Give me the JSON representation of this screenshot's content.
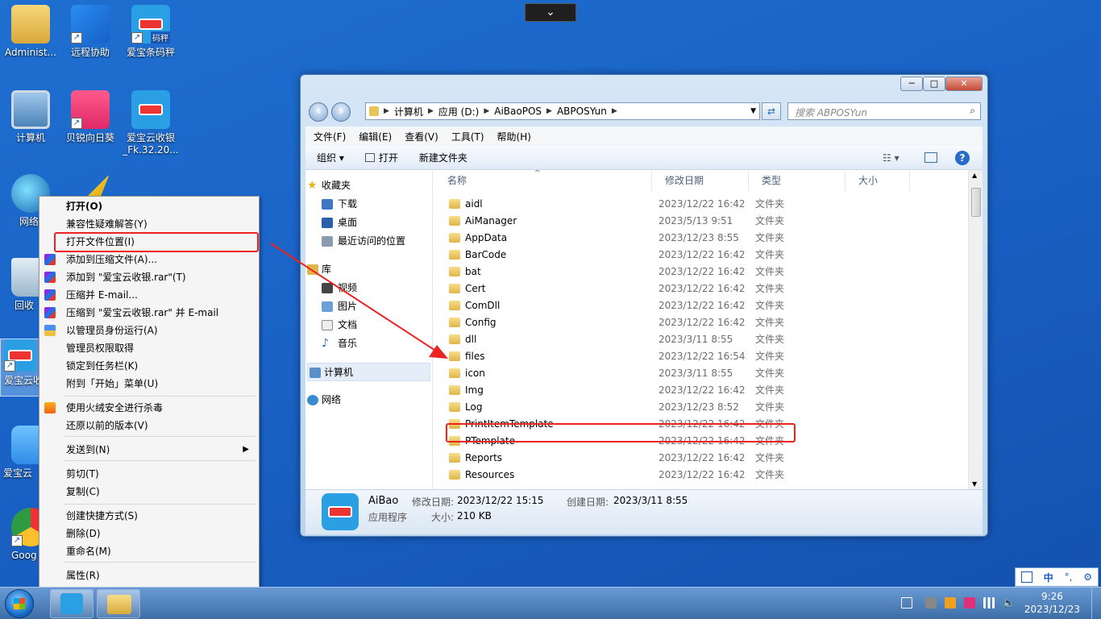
{
  "desktop": {
    "icons": [
      {
        "label": "Administ..."
      },
      {
        "label": "远程协助"
      },
      {
        "label": "爱宝条码秤"
      },
      {
        "label": "计算机"
      },
      {
        "label": "贝锐向日葵"
      },
      {
        "label": "爱宝云收银"
      },
      {
        "label": "_Fk.32.20..."
      },
      {
        "label": "网络"
      },
      {
        "label": "回收"
      },
      {
        "label": "爱宝云"
      },
      {
        "label": "爱宝云收"
      },
      {
        "label": "Goog"
      }
    ],
    "badge_text": "码秤"
  },
  "top_dropdown": {
    "glyph": "⌄"
  },
  "explorer": {
    "window_buttons": {
      "minimize": "─",
      "maximize": "□",
      "close": "✕"
    },
    "nav": {
      "back": "‹",
      "forward": "›"
    },
    "address": {
      "crumbs": [
        "计算机",
        "应用 (D:)",
        "AiBaoPOS",
        "ABPOSYun"
      ]
    },
    "search": {
      "placeholder": "搜索 ABPOSYun"
    },
    "menu": [
      "文件(F)",
      "编辑(E)",
      "查看(V)",
      "工具(T)",
      "帮助(H)"
    ],
    "toolbar": {
      "organize": "组织 ▾",
      "open": "打开",
      "new_folder": "新建文件夹",
      "help": "?"
    },
    "navpane": {
      "favorites": "收藏夹",
      "downloads": "下载",
      "desktop": "桌面",
      "recent": "最近访问的位置",
      "library": "库",
      "videos": "视频",
      "pictures": "图片",
      "documents": "文档",
      "music": "音乐",
      "computer": "计算机",
      "network": "网络"
    },
    "columns": {
      "name": "名称",
      "date": "修改日期",
      "type": "类型",
      "size": "大小"
    },
    "files": [
      {
        "name": "aidl",
        "date": "2023/12/22 16:42",
        "type": "文件夹"
      },
      {
        "name": "AiManager",
        "date": "2023/5/13 9:51",
        "type": "文件夹"
      },
      {
        "name": "AppData",
        "date": "2023/12/23 8:55",
        "type": "文件夹"
      },
      {
        "name": "BarCode",
        "date": "2023/12/22 16:42",
        "type": "文件夹"
      },
      {
        "name": "bat",
        "date": "2023/12/22 16:42",
        "type": "文件夹"
      },
      {
        "name": "Cert",
        "date": "2023/12/22 16:42",
        "type": "文件夹"
      },
      {
        "name": "ComDll",
        "date": "2023/12/22 16:42",
        "type": "文件夹"
      },
      {
        "name": "Config",
        "date": "2023/12/22 16:42",
        "type": "文件夹"
      },
      {
        "name": "dll",
        "date": "2023/3/11 8:55",
        "type": "文件夹"
      },
      {
        "name": "files",
        "date": "2023/12/22 16:54",
        "type": "文件夹"
      },
      {
        "name": "icon",
        "date": "2023/3/11 8:55",
        "type": "文件夹"
      },
      {
        "name": "Img",
        "date": "2023/12/22 16:42",
        "type": "文件夹"
      },
      {
        "name": "Log",
        "date": "2023/12/23 8:52",
        "type": "文件夹"
      },
      {
        "name": "PrintItemTemplate",
        "date": "2023/12/22 16:42",
        "type": "文件夹"
      },
      {
        "name": "PTemplate",
        "date": "2023/12/22 16:42",
        "type": "文件夹"
      },
      {
        "name": "Reports",
        "date": "2023/12/22 16:42",
        "type": "文件夹"
      },
      {
        "name": "Resources",
        "date": "2023/12/22 16:42",
        "type": "文件夹"
      }
    ],
    "highlighted_row": "files",
    "details": {
      "name": "AiBao",
      "kind": "应用程序",
      "modified_label": "修改日期:",
      "modified_value": "2023/12/22 15:15",
      "created_label": "创建日期:",
      "created_value": "2023/3/11 8:55",
      "size_label": "大小:",
      "size_value": "210 KB"
    }
  },
  "context_menu": {
    "items": [
      {
        "label": "打开(O)",
        "bold": true
      },
      {
        "label": "兼容性疑难解答(Y)"
      },
      {
        "label": "打开文件位置(I)",
        "highlighted": true
      },
      {
        "label": "添加到压缩文件(A)...",
        "icon": "rar-icon"
      },
      {
        "label": "添加到 \"爱宝云收银.rar\"(T)",
        "icon": "rar-icon"
      },
      {
        "label": "压缩并 E-mail...",
        "icon": "rar-icon"
      },
      {
        "label": "压缩到 \"爱宝云收银.rar\" 并 E-mail",
        "icon": "rar-icon"
      },
      {
        "label": "以管理员身份运行(A)",
        "icon": "uac-shield-icon"
      },
      {
        "label": "管理员权限取得"
      },
      {
        "label": "锁定到任务栏(K)"
      },
      {
        "label": "附到「开始」菜单(U)"
      },
      {
        "label": "使用火绒安全进行杀毒",
        "icon": "huorong-icon"
      },
      {
        "label": "还原以前的版本(V)"
      },
      {
        "label": "发送到(N)",
        "submenu": true
      },
      {
        "label": "剪切(T)"
      },
      {
        "label": "复制(C)"
      },
      {
        "label": "创建快捷方式(S)"
      },
      {
        "label": "删除(D)"
      },
      {
        "label": "重命名(M)"
      },
      {
        "label": "属性(R)"
      }
    ],
    "submenu_glyph": "▶"
  },
  "taskbar": {
    "clock_time": "9:26",
    "clock_date": "2023/12/23"
  },
  "language_bar": {
    "ime": "中",
    "punct": "°,",
    "settings": "⚙"
  },
  "colors": {
    "highlight_red": "#e22222",
    "accent_blue": "#1a62c6"
  }
}
